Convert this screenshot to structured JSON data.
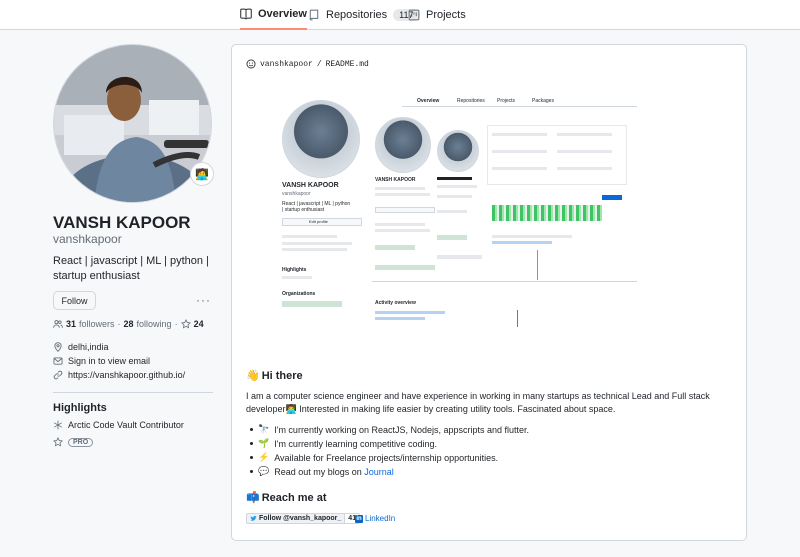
{
  "tabs": [
    {
      "label": "Overview",
      "icon": "book-icon",
      "active": true
    },
    {
      "label": "Repositories",
      "icon": "repo-icon",
      "count": "117"
    },
    {
      "label": "Projects",
      "icon": "project-icon"
    }
  ],
  "profile": {
    "name": "VANSH KAPOOR",
    "username": "vanshkapoor",
    "bio": "React | javascript | ML | python | startup enthusiast",
    "follow_label": "Follow",
    "more_label": "···",
    "followers_count": "31",
    "followers_label": "followers",
    "following_count": "28",
    "following_label": "following",
    "stars_count": "24",
    "separator": "·",
    "location": "delhi,india",
    "email": "Sign in to view email",
    "website": "https://vanshkapoor.github.io/",
    "status_emoji": "🧑‍💻"
  },
  "highlights": {
    "title": "Highlights",
    "items": [
      {
        "label": "Arctic Code Vault Contributor",
        "icon": "snowflake-icon"
      },
      {
        "label": "PRO",
        "icon": "star-icon"
      }
    ]
  },
  "readme": {
    "owner": "vanshkapoor",
    "slash": "/",
    "file": "README",
    "ext": ".md",
    "greeting_emoji": "👋",
    "greeting": "Hi there",
    "intro": "I am a computer science engineer and have experience in working in many startups as technical Lead and Full stack developer👨‍💻 Interested in making life easier by creating utility tools. Fascinated about space.",
    "list": [
      {
        "emoji": "🔭",
        "text": "I'm currently working on ReactJS, Nodejs, appscripts and flutter."
      },
      {
        "emoji": "🌱",
        "text": "I'm currently learning competitive coding."
      },
      {
        "emoji": "⚡",
        "text": "Available for Freelance projects/internship opportunities."
      },
      {
        "emoji": "💬",
        "text": "Read out my blogs on ",
        "link": "Journal"
      }
    ],
    "reach_emoji": "📫",
    "reach_title": "Reach me at",
    "twitter_label": "Follow @vansh_kapoor_",
    "twitter_count": "41",
    "linkedin_label": "LinkedIn",
    "linkedin_icon": "in"
  },
  "mini": {
    "tabs": [
      "Overview",
      "Repositories",
      "Projects",
      "Packages"
    ],
    "name": "VANSH KAPOOR",
    "username": "vanshkapoor",
    "bio": "React | javascript | ML | python | startup enthusiast",
    "edit": "Edit profile",
    "highlights": "Highlights",
    "orgs": "Organizations",
    "activity": "Activity overview"
  },
  "colors": {
    "accent_tab": "#fd8c73",
    "link": "#0969da",
    "border": "#d0d7de",
    "text": "#1f2328",
    "muted": "#636c76"
  }
}
